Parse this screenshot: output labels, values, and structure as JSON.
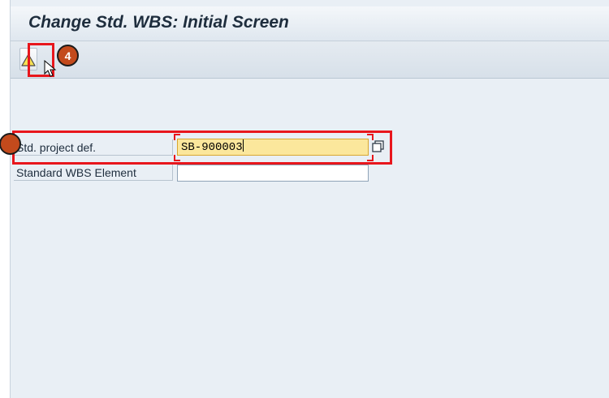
{
  "window": {
    "title": "Change Std. WBS: Initial Screen"
  },
  "toolbar": {
    "execute_icon": "warning-triangle-icon"
  },
  "annotations": {
    "step_4": "4"
  },
  "form": {
    "std_project_def": {
      "label": "Std. project def.",
      "value": "SB-900003"
    },
    "standard_wbs_element": {
      "label": "Standard WBS Element",
      "value": ""
    }
  },
  "colors": {
    "highlight": "#e8161c",
    "badge": "#c34a1c",
    "required_field": "#fbe79c",
    "background": "#e9eff5"
  }
}
